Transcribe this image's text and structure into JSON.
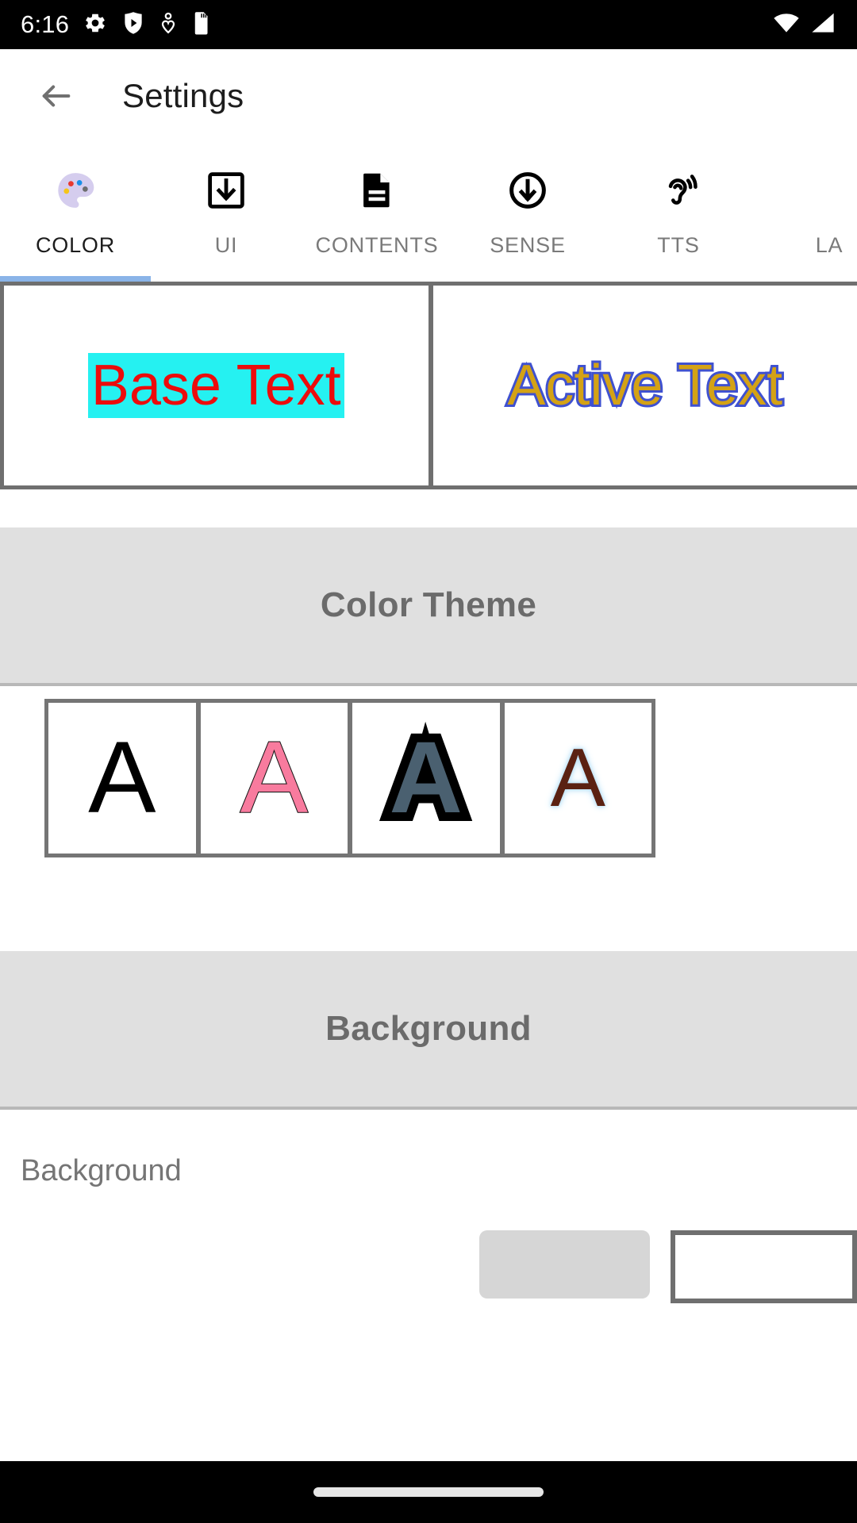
{
  "statusbar": {
    "time": "6:16",
    "left_icons": [
      "gear-icon",
      "shield-play-icon",
      "heart-location-icon",
      "sd-card-icon"
    ],
    "right_icons": [
      "wifi-icon",
      "signal-icon"
    ]
  },
  "appbar": {
    "back_icon": "back-arrow-icon",
    "title": "Settings"
  },
  "tabs": [
    {
      "label": "COLOR",
      "icon": "palette-icon",
      "active": true
    },
    {
      "label": "UI",
      "icon": "download-box-icon",
      "active": false
    },
    {
      "label": "CONTENTS",
      "icon": "document-lines-icon",
      "active": false
    },
    {
      "label": "SENSE",
      "icon": "circle-arrow-down-icon",
      "active": false
    },
    {
      "label": "TTS",
      "icon": "ear-sound-icon",
      "active": false
    },
    {
      "label": "LA",
      "icon": "",
      "active": false
    }
  ],
  "preview": {
    "base": {
      "text": "Base Text",
      "color": "#ec0c0c",
      "highlight": "#25f1f1"
    },
    "active": {
      "text": "Active Text",
      "color": "#d4a215",
      "outline": "#3f51d0"
    }
  },
  "color_theme": {
    "header": "Color Theme",
    "swatches": [
      {
        "letter": "A",
        "name": "theme-black",
        "fill": "#000000",
        "stroke": ""
      },
      {
        "letter": "A",
        "name": "theme-pink",
        "fill": "#f87b9e",
        "stroke": "#111111"
      },
      {
        "letter": "A",
        "name": "theme-dark-slate",
        "fill": "#4a6070",
        "stroke": "#000000"
      },
      {
        "letter": "A",
        "name": "theme-brown-glow",
        "fill": "#5a2112",
        "stroke": "#bfe3f7"
      }
    ]
  },
  "background": {
    "header": "Background",
    "row_label": "Background",
    "chip_color": "#d6d6d6",
    "box_border": "#6f6f6f"
  },
  "navbar": {
    "home_indicator": "home-indicator"
  }
}
